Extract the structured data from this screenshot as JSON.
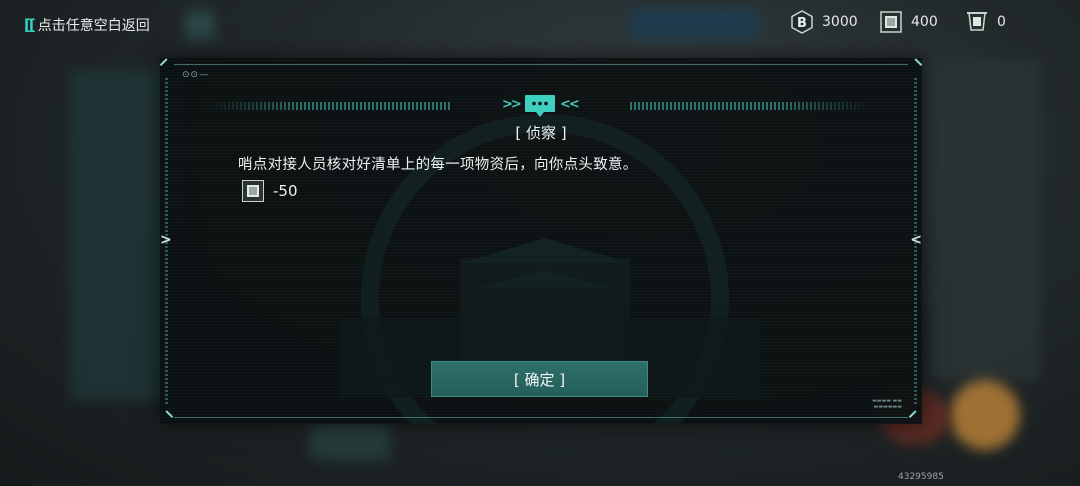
{
  "topbar": {
    "back_hint": "点击任意空白返回",
    "back_icon": "double-bracket-icon"
  },
  "resources": [
    {
      "icon": "coin-b-icon",
      "value": "3000"
    },
    {
      "icon": "supply-crate-icon",
      "value": "400"
    },
    {
      "icon": "ticket-icon",
      "value": "0"
    }
  ],
  "dialog": {
    "title": "[ 侦察 ]",
    "message": "哨点对接人员核对好清单上的每一项物资后，向你点头致意。",
    "cost": {
      "icon": "supply-crate-icon",
      "value": "-50"
    },
    "confirm_label": "[ 确定 ]",
    "header_icon": "chat-bubble-icon"
  },
  "footer": {
    "uid": "43295985"
  },
  "colors": {
    "accent": "#35d1c3",
    "button": "#2b6a64",
    "panel": "#0b1011"
  }
}
